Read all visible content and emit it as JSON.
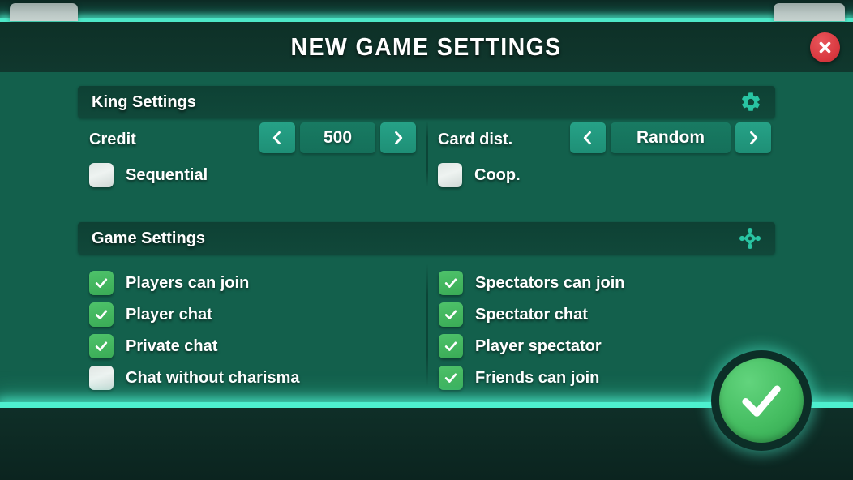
{
  "window": {
    "title": "NEW GAME SETTINGS",
    "close_icon": "close-x-icon",
    "tab_left": "",
    "tab_right": ""
  },
  "colors": {
    "panel_bg": "#13604c",
    "header_bg": "#0e4134",
    "accent_cyan": "#4ef0cf",
    "arrow_green": "#26a287",
    "value_green": "#187a62",
    "check_green": "#45bd61",
    "close_red": "#d9383f",
    "text_white": "#ffffff"
  },
  "king_section": {
    "title": "King Settings",
    "icon": "gear-icon",
    "credit": {
      "label": "Credit",
      "value": "500",
      "prev_icon": "chevron-left-icon",
      "next_icon": "chevron-right-icon"
    },
    "card_dist": {
      "label": "Card dist.",
      "value": "Random",
      "prev_icon": "chevron-left-icon",
      "next_icon": "chevron-right-icon"
    },
    "checkboxes": [
      {
        "label": "Sequential",
        "checked": false
      },
      {
        "label": "Coop.",
        "checked": false
      }
    ]
  },
  "game_section": {
    "title": "Game Settings",
    "icon": "cog-sprocket-icon",
    "left_column": [
      {
        "label": "Players can join",
        "checked": true
      },
      {
        "label": "Player chat",
        "checked": true
      },
      {
        "label": "Private chat",
        "checked": true
      },
      {
        "label": "Chat without charisma",
        "checked": false
      }
    ],
    "right_column": [
      {
        "label": "Spectators can join",
        "checked": true
      },
      {
        "label": "Spectator chat",
        "checked": true
      },
      {
        "label": "Player spectator",
        "checked": true
      },
      {
        "label": "Friends can join",
        "checked": true
      }
    ]
  },
  "footer": {
    "confirm_icon": "checkmark-icon"
  }
}
